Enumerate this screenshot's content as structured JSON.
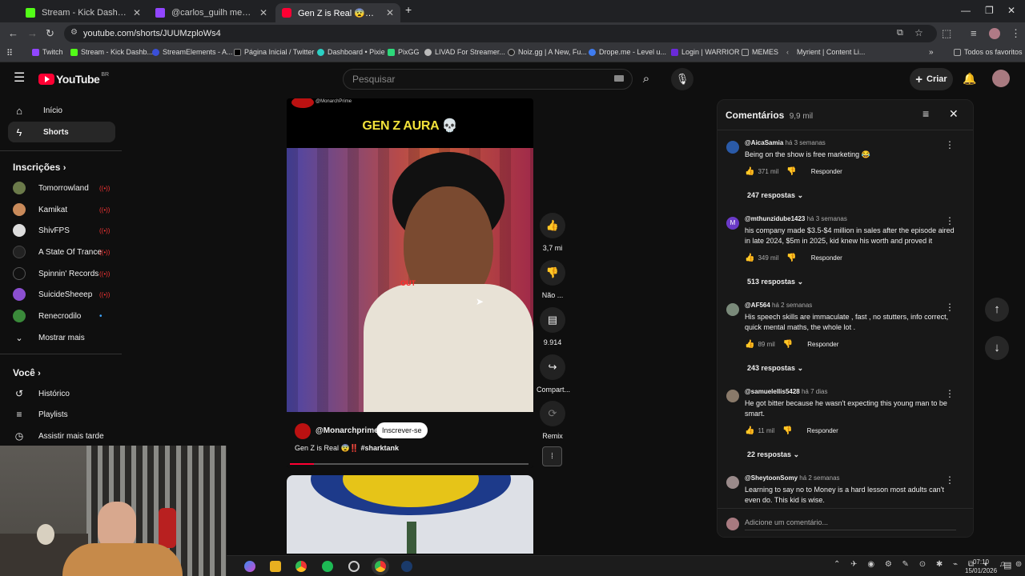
{
  "browser": {
    "tabs": [
      {
        "label": "Stream - Kick Dashboard",
        "color": "#53fc18"
      },
      {
        "label": "@carlos_guilh mentioned y",
        "color": "#9146ff"
      },
      {
        "label": "Gen Z is Real 😨‼️ #sharkta",
        "color": "#ff0033"
      }
    ],
    "url": "youtube.com/shorts/JUUMzploWs4",
    "bookmarks": [
      {
        "label": "Twitch",
        "color": "#9146ff"
      },
      {
        "label": "Stream - Kick Dashb...",
        "color": "#53fc18"
      },
      {
        "label": "StreamElements - A...",
        "color": "#3a4fd8"
      },
      {
        "label": "Página Inicial / Twitter",
        "color": "#222222"
      },
      {
        "label": "Dashboard • Pixie",
        "color": "#2bd0c4"
      },
      {
        "label": "PixGG",
        "color": "#2dd87a"
      },
      {
        "label": "LIVAD For Streamer...",
        "color": "#bbbbbb"
      },
      {
        "label": "Noiz.gg | A New, Fu...",
        "color": "#222222"
      },
      {
        "label": "Drope.me - Level u...",
        "color": "#3f7cf0"
      },
      {
        "label": "Login | WARRIOR",
        "color": "#6a2ad8"
      },
      {
        "label": "MEMES",
        "color": "#999999"
      },
      {
        "label": "Myrient | Content Li...",
        "color": "#888888"
      }
    ],
    "all_bookmarks": "Todos os favoritos"
  },
  "youtube": {
    "logo_text": "YouTube",
    "region": "BR",
    "search_placeholder": "Pesquisar",
    "create_label": "Criar",
    "accent": "#ff0033"
  },
  "sidebar": {
    "home": "Início",
    "shorts": "Shorts",
    "subscriptions_heading": "Inscrições",
    "subscriptions": [
      {
        "name": "Tomorrowland",
        "live": true,
        "color": "#6b7a4a"
      },
      {
        "name": "Kamikat",
        "live": true,
        "color": "#c98a5a"
      },
      {
        "name": "ShivFPS",
        "live": true,
        "color": "#dddddd"
      },
      {
        "name": "A State Of Trance",
        "live": true,
        "color": "#222222"
      },
      {
        "name": "Spinnin' Records",
        "live": true,
        "color": "#111111"
      },
      {
        "name": "SuicideSheeep",
        "live": true,
        "color": "#8b4fd0"
      },
      {
        "name": "Renecrodilo",
        "live": false,
        "color": "#3a8a3a"
      }
    ],
    "show_more": "Mostrar mais",
    "you_heading": "Você",
    "history": "Histórico",
    "playlists": "Playlists",
    "watch_later": "Assistir mais tarde"
  },
  "short": {
    "overlay_channel": "@MonarchPrime",
    "title_banner": "GEN Z AURA 💀",
    "out_text": "OUT",
    "channel": "@Monarchprime",
    "subscribe": "Inscrever-se",
    "caption_text": "Gen Z is Real 😨‼️",
    "caption_tag": "#sharktank",
    "progress": 0.1,
    "actions": {
      "likes": "3,7 mi",
      "dislike": "Não ...",
      "comments": "9.914",
      "share": "Compart...",
      "remix": "Remix"
    }
  },
  "comments_panel": {
    "title": "Comentários",
    "count": "9,9 mil",
    "reply_label": "Responder",
    "add_placeholder": "Adicione um comentário...",
    "items": [
      {
        "author": "@AicaSamia",
        "time": "há 3 semanas",
        "text": "Being on the show is free marketing 😂",
        "likes": "371 mil",
        "replies": "247 respostas",
        "avatar": "#2a5aa8"
      },
      {
        "author": "@mthunzidube1423",
        "time": "há 3 semanas",
        "text": "his company made $3.5-$4 million in sales after the episode aired in late 2024, $5m in 2025, kid knew his worth and proved it",
        "likes": "349 mil",
        "replies": "513 respostas",
        "avatar": "#6a3ac8"
      },
      {
        "author": "@AF564",
        "time": "há 2 semanas",
        "text": "His speech skills are immaculate , fast , no stutters, info correct, quick mental maths, the whole lot .",
        "likes": "89 mil",
        "replies": "243 respostas",
        "avatar": "#7a8a7a"
      },
      {
        "author": "@samuelellis5428",
        "time": "há 7 dias",
        "text": "He got bitter because he wasn't expecting this young man to be smart.",
        "likes": "11 mil",
        "replies": "22 respostas",
        "avatar": "#8a7a6a"
      },
      {
        "author": "@SheytoonSomy",
        "time": "há 2 semanas",
        "text": "Learning to say no to Money is a hard lesson most adults can't even do. This kid is wise.",
        "likes": "",
        "replies": "",
        "avatar": "#9a8a8a"
      }
    ]
  },
  "system": {
    "time": "07:10",
    "date": "15/01/2026"
  }
}
